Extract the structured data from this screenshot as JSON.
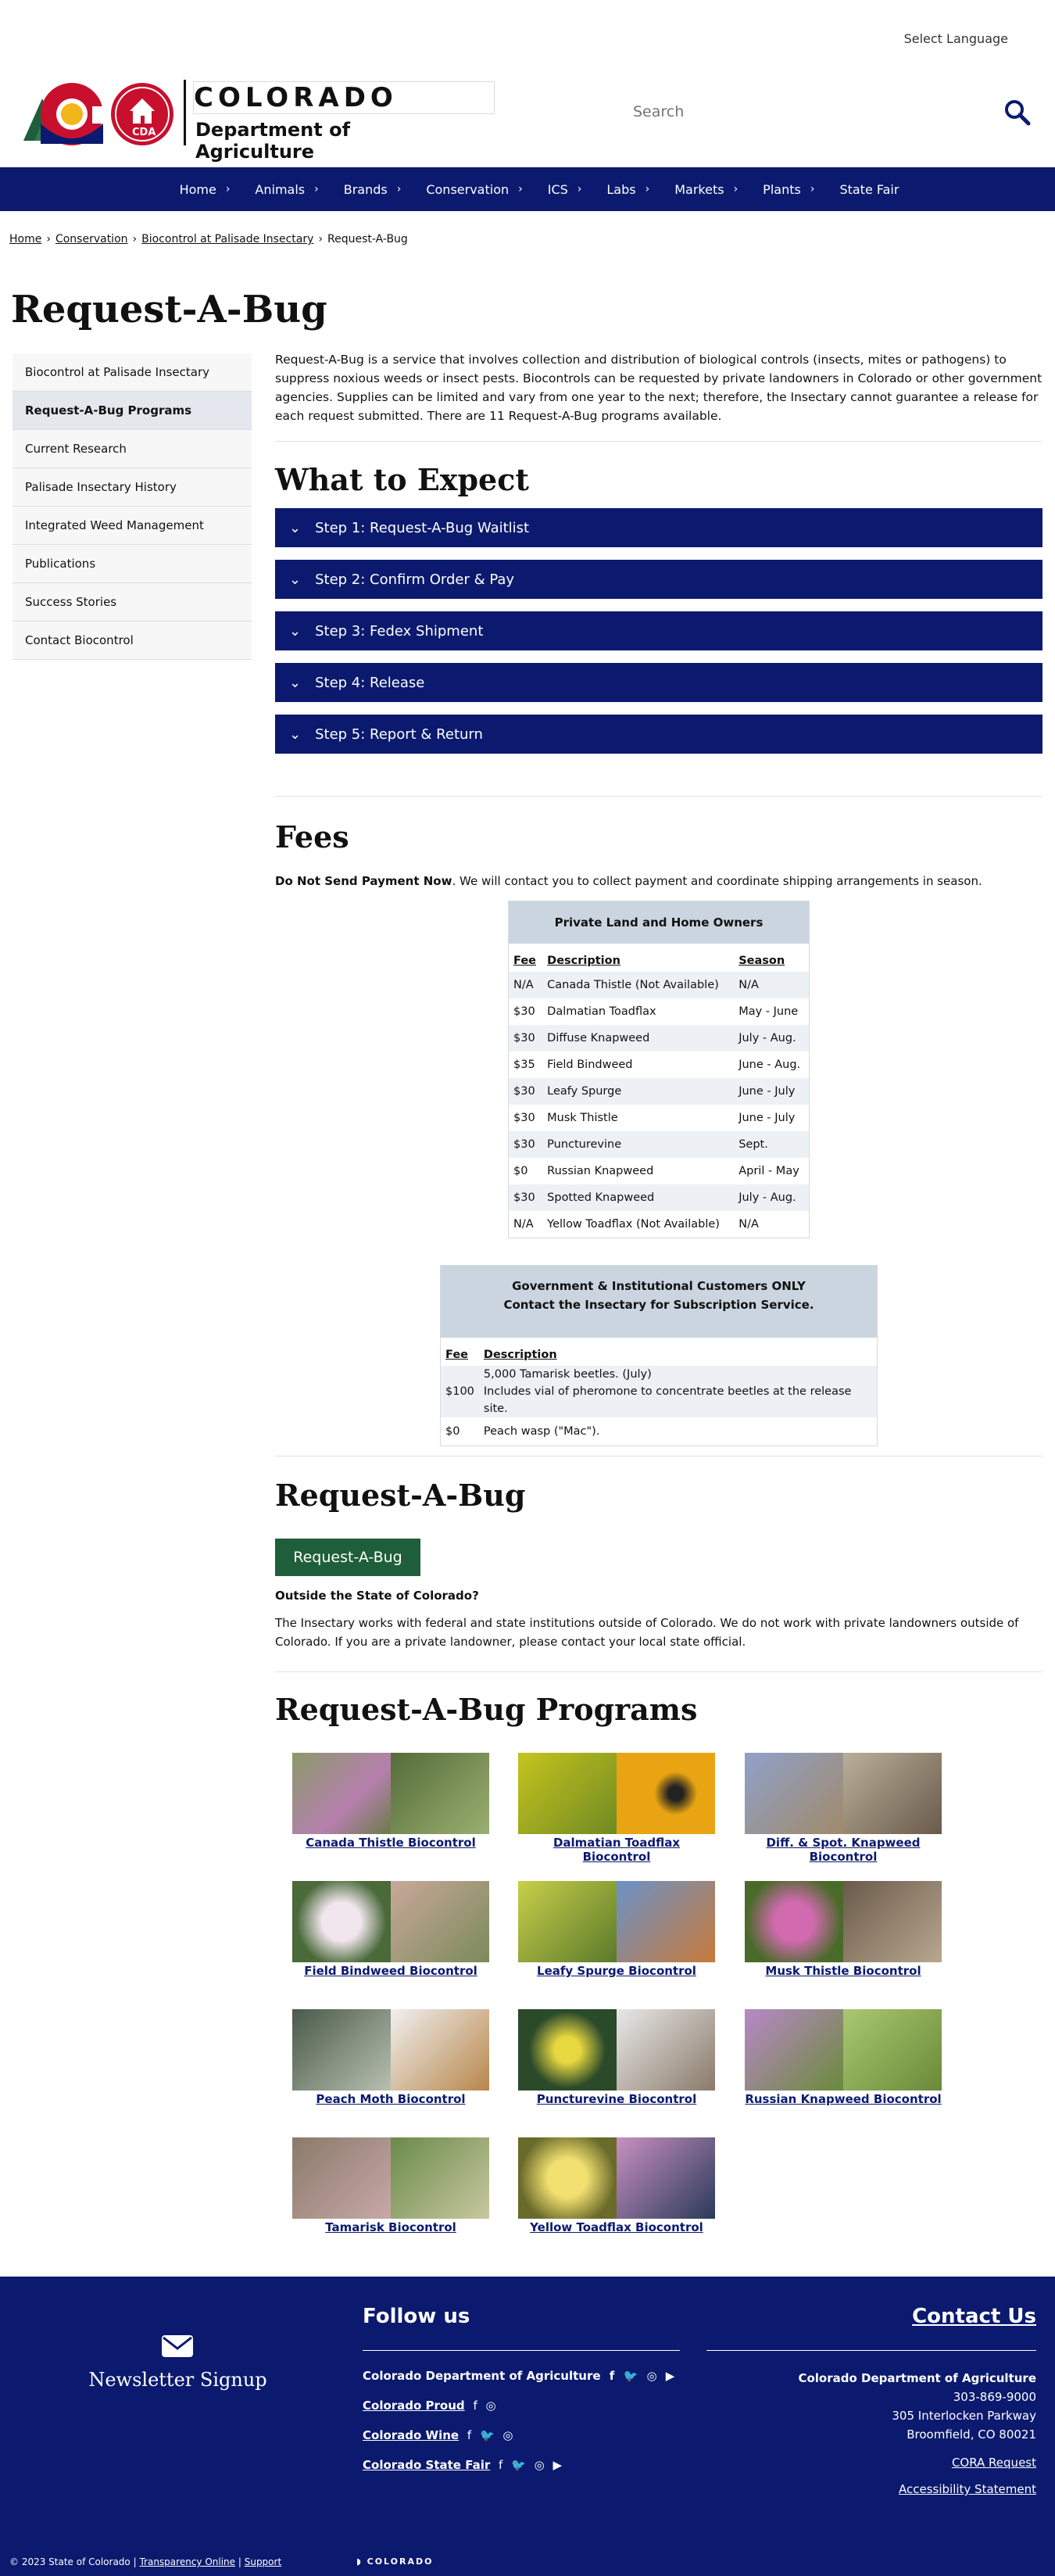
{
  "header": {
    "language": "Select Language",
    "logo_line1": "COLORADO",
    "logo_line2": "Department of Agriculture",
    "logo_badge": "CDA",
    "search_placeholder": "Search"
  },
  "nav": [
    "Home",
    "Animals",
    "Brands",
    "Conservation",
    "ICS",
    "Labs",
    "Markets",
    "Plants",
    "State Fair"
  ],
  "breadcrumb": [
    "Home",
    "Conservation",
    "Biocontrol at Palisade Insectary",
    "Request-A-Bug"
  ],
  "page_title": "Request-A-Bug",
  "sidebar": [
    "Biocontrol at Palisade Insectary",
    "Request-A-Bug Programs",
    "Current Research",
    "Palisade Insectary History",
    "Integrated Weed Management",
    "Publications",
    "Success Stories",
    "Contact Biocontrol"
  ],
  "intro": "Request-A-Bug is a service that involves collection and distribution of biological controls (insects, mites or pathogens) to suppress noxious weeds or insect pests. Biocontrols can be requested by private landowners in Colorado or other government agencies. Supplies can be limited and vary from one year to the next; therefore, the Insectary cannot guarantee a release for each request submitted. There are 11 Request-A-Bug programs available.",
  "expect": {
    "title": "What to Expect",
    "steps": [
      "Step 1: Request-A-Bug Waitlist",
      "Step 2: Confirm Order & Pay",
      "Step 3: Fedex Shipment",
      "Step 4: Release",
      "Step 5: Report & Return"
    ]
  },
  "fees": {
    "title": "Fees",
    "note_bold": "Do Not Send Payment Now",
    "note_rest": ". We will contact you to collect payment and coordinate shipping arrangements in season.",
    "table1": {
      "caption": "Private Land and Home Owners",
      "headers": [
        "Fee",
        "Description",
        "Season"
      ],
      "rows": [
        [
          "N/A",
          "Canada Thistle (Not Available)",
          "N/A"
        ],
        [
          "$30",
          "Dalmatian Toadflax",
          "May - June"
        ],
        [
          "$30",
          "Diffuse Knapweed",
          "July - Aug."
        ],
        [
          "$35",
          "Field Bindweed",
          "June - Aug."
        ],
        [
          "$30",
          "Leafy Spurge",
          "June - July"
        ],
        [
          "$30",
          "Musk Thistle",
          "June - July"
        ],
        [
          "$30",
          "Puncturevine",
          "Sept."
        ],
        [
          "$0",
          "Russian Knapweed",
          "April - May"
        ],
        [
          "$30",
          "Spotted Knapweed",
          "July - Aug."
        ],
        [
          "N/A",
          "Yellow Toadflax (Not Available)",
          "N/A"
        ]
      ]
    },
    "table2": {
      "caption_line1": "Government & Institutional Customers ONLY",
      "caption_line2": "Contact the Insectary for Subscription Service.",
      "headers": [
        "Fee",
        "Description"
      ],
      "row1_fee": "$100",
      "row1_desc1": "5,000 Tamarisk beetles. (July)",
      "row1_desc2": "Includes vial of pheromone to concentrate beetles at the release site.",
      "row2_fee": "$0",
      "row2_desc": "Peach wasp (\"Mac\")."
    }
  },
  "rab": {
    "title": "Request-A-Bug",
    "button": "Request-A-Bug",
    "outside_title": "Outside the State of Colorado?",
    "outside_text": "The Insectary works with federal and state institutions outside of Colorado. We do not work with private landowners outside of Colorado. If you are a private landowner, please contact your local state official."
  },
  "programs": {
    "title": "Request-A-Bug Programs",
    "items": [
      "Canada Thistle Biocontrol",
      "Dalmatian Toadflax Biocontrol",
      "Diff. & Spot. Knapweed Biocontrol",
      "Field Bindweed Biocontrol",
      "Leafy Spurge Biocontrol",
      "Musk Thistle Biocontrol",
      "Peach Moth Biocontrol",
      "Puncturevine Biocontrol",
      "Russian Knapweed Biocontrol",
      "Tamarisk Biocontrol",
      "Yellow Toadflax Biocontrol"
    ]
  },
  "footer": {
    "newsletter": "Newsletter Signup",
    "follow": "Follow us",
    "social": [
      "Colorado Department of Agriculture",
      "Colorado Proud",
      "Colorado Wine",
      "Colorado State Fair"
    ],
    "contact_title": "Contact Us",
    "contact_name": "Colorado Department of Agriculture",
    "phone": "303-869-9000",
    "address1": "305 Interlocken Parkway",
    "address2": "Broomfield, CO 80021",
    "cora": "CORA Request",
    "access": "Accessibility Statement",
    "copyright": "© 2023 State of Colorado",
    "transparency": "Transparency Online",
    "support": "Support",
    "state_logo": "COLORADO"
  },
  "colors": {
    "navy": "#0b1a6e",
    "green": "#1f5e3a",
    "table_header": "#cbd5df"
  }
}
